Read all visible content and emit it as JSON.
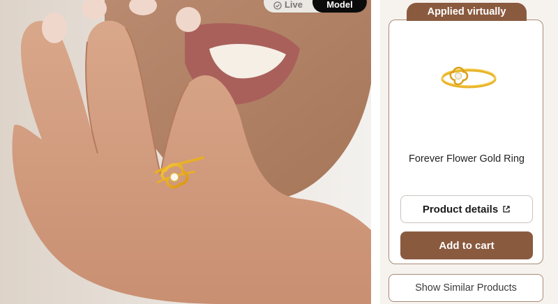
{
  "mode_toggle": {
    "live_label": "Live",
    "model_label": "Model",
    "selected": "Model"
  },
  "product_panel": {
    "applied_label": "Applied virtually",
    "product_name": "Forever Flower Gold Ring",
    "details_label": "Product details",
    "add_to_cart_label": "Add to cart",
    "similar_label": "Show Similar Products"
  },
  "colors": {
    "brand_brown": "#8a5a3f",
    "card_border": "#a98a74",
    "toggle_active": "#0b0b0b",
    "gold": "#e6a91c"
  },
  "icons": {
    "live_icon": "check-circle-icon",
    "details_icon": "external-link-icon"
  }
}
